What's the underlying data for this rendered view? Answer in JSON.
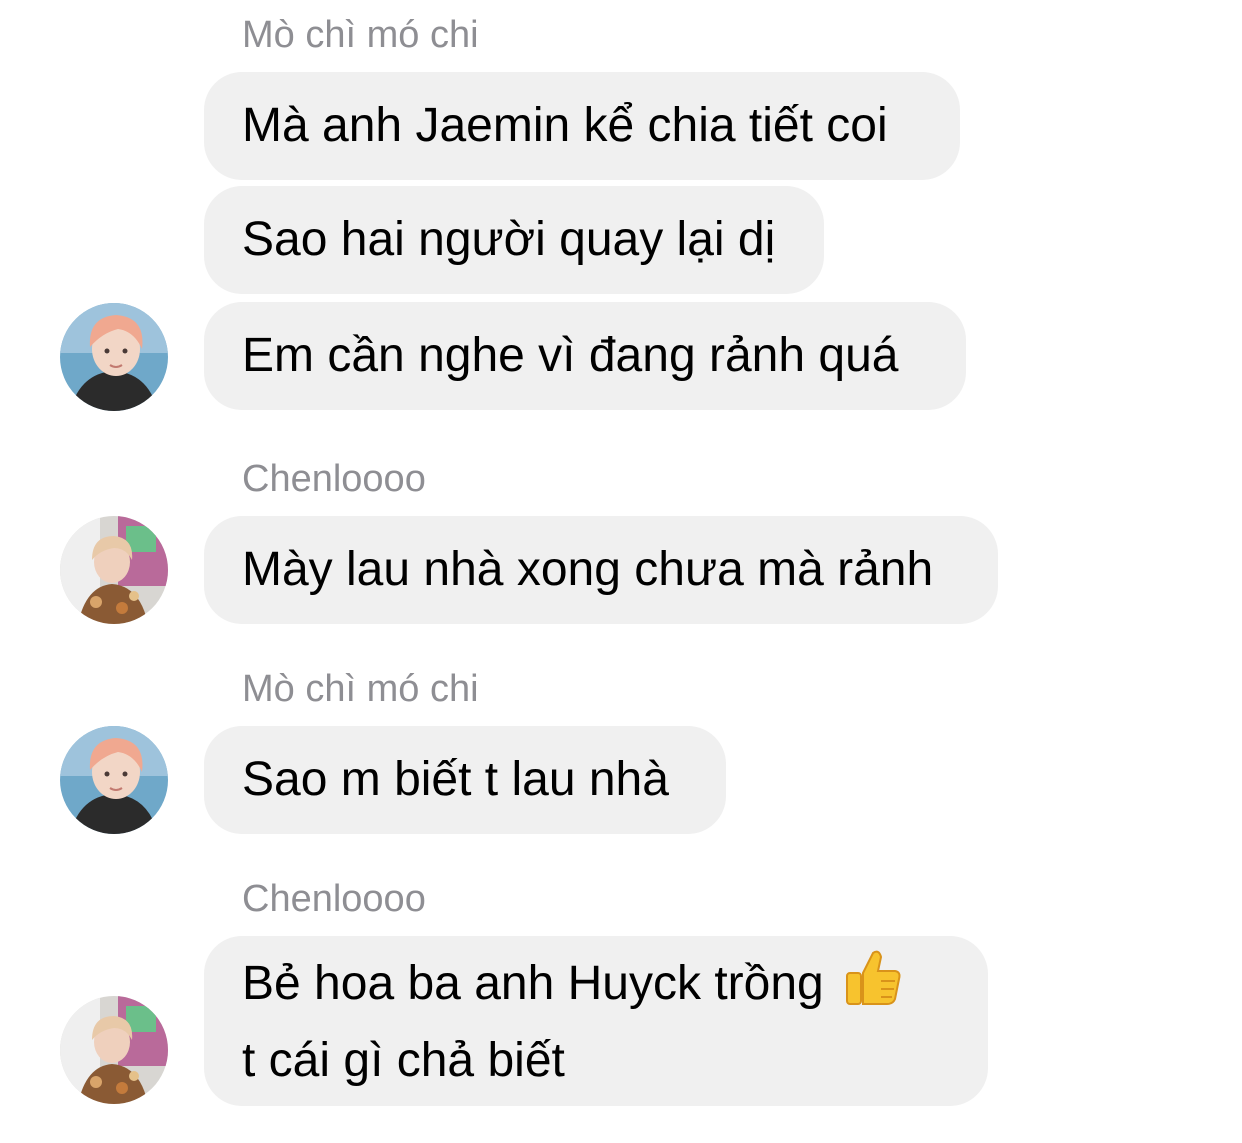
{
  "colors": {
    "bubble": "#f0f0f0",
    "sender": "#8e8e93",
    "text": "#000000",
    "background": "#ffffff"
  },
  "messages": [
    {
      "sender": "Mò chì mó chi"
    },
    {
      "text": "Mà anh Jaemin kể chia tiết coi"
    },
    {
      "text": "Sao hai người quay lại dị"
    },
    {
      "text": "Em cần nghe vì đang rảnh quá",
      "avatar": "pink-hair-avatar"
    },
    {
      "sender": "Chenloooo"
    },
    {
      "text": "Mày lau nhà xong chưa mà rảnh",
      "avatar": "floral-shirt-avatar"
    },
    {
      "sender": "Mò chì mó chi"
    },
    {
      "text": "Sao m biết t lau nhà",
      "avatar": "pink-hair-avatar"
    },
    {
      "sender": "Chenloooo"
    },
    {
      "text_line1": "Bẻ hoa ba anh Huyck trồng ",
      "emoji": "thumbs-up-icon",
      "text_line2": "t cái gì chả biết",
      "avatar": "floral-shirt-avatar"
    }
  ]
}
